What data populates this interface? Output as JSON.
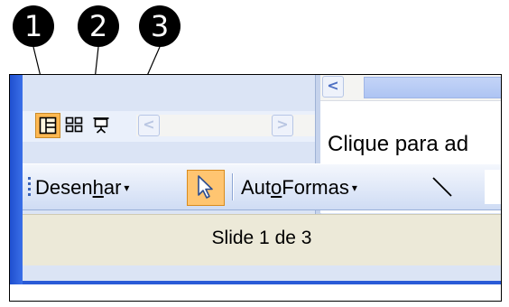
{
  "callouts": [
    "1",
    "2",
    "3"
  ],
  "icons": {
    "normal_view": "normal-view-icon",
    "slide_sorter": "slide-sorter-view-icon",
    "slideshow": "slideshow-view-icon",
    "scroll_left": "chevron-left-icon",
    "scroll_right": "chevron-right-icon",
    "pointer": "arrow-pointer-icon",
    "line": "line-tool-icon"
  },
  "scroll_glyphs": {
    "left": "<",
    "right": ">"
  },
  "notes": {
    "text": "Clique para ad"
  },
  "toolbar": {
    "draw_pre": "Desen",
    "draw_hot": "h",
    "draw_post": "ar",
    "autoshapes_pre": "Aut",
    "autoshapes_hot": "o",
    "autoshapes_post": "Formas",
    "caret": "▾"
  },
  "status": {
    "slide": "Slide 1 de 3"
  },
  "colors": {
    "active_view": "#ffb851",
    "titlebar_blue": "#2a5bd7",
    "panel": "#dbe4f5"
  }
}
